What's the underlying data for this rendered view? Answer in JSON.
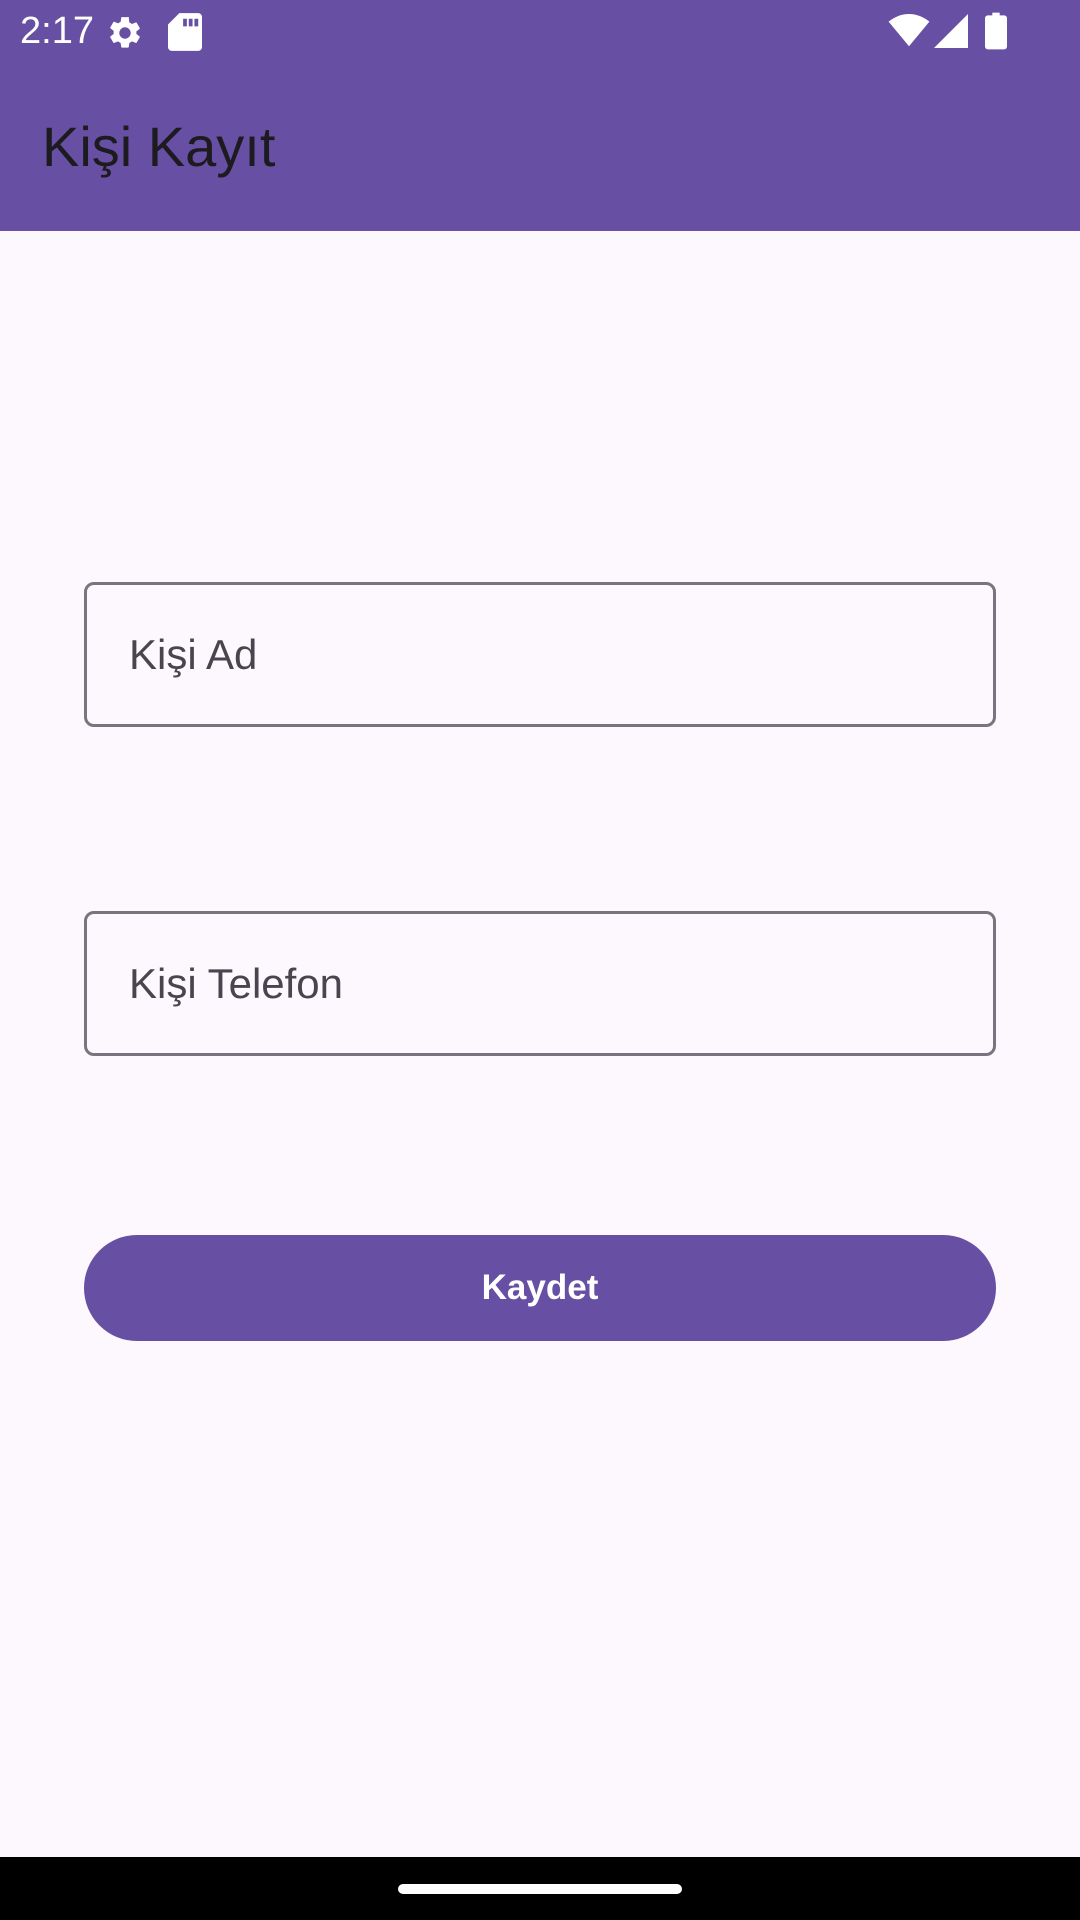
{
  "status_bar": {
    "time": "2:17",
    "icons": [
      "gear-icon",
      "sd-card-icon",
      "wifi-icon",
      "cellular-signal-icon",
      "battery-icon"
    ]
  },
  "app_bar": {
    "title": "Kişi Kayıt"
  },
  "form": {
    "name_field": {
      "value": "",
      "placeholder": "Kişi Ad"
    },
    "phone_field": {
      "value": "",
      "placeholder": "Kişi Telefon"
    },
    "save_label": "Kaydet"
  },
  "colors": {
    "primary": "#6750A4",
    "background": "#FDF7FE",
    "outline": "#79747E",
    "on_surface": "#1D1B20",
    "on_primary": "#FFFFFF"
  }
}
